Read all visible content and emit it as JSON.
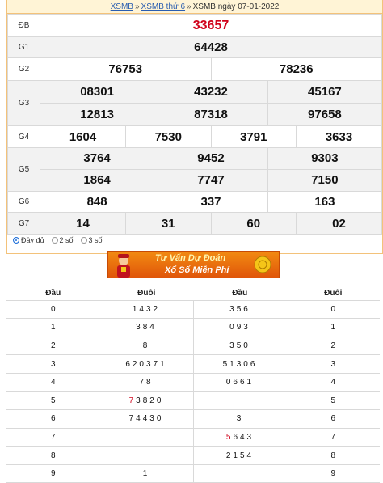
{
  "breadcrumb": {
    "link1": "XSMB",
    "link2": "XSMB thứ 6",
    "title": "XSMB ngày 07-01-2022"
  },
  "results": {
    "db": {
      "label": "ĐB",
      "nums": [
        "33657"
      ]
    },
    "g1": {
      "label": "G1",
      "nums": [
        "64428"
      ]
    },
    "g2": {
      "label": "G2",
      "nums": [
        "76753",
        "78236"
      ]
    },
    "g3": {
      "label": "G3",
      "nums": [
        "08301",
        "43232",
        "45167",
        "12813",
        "87318",
        "97658"
      ]
    },
    "g4": {
      "label": "G4",
      "nums": [
        "1604",
        "7530",
        "3791",
        "3633"
      ]
    },
    "g5": {
      "label": "G5",
      "nums": [
        "3764",
        "9452",
        "9303",
        "1864",
        "7747",
        "7150"
      ]
    },
    "g6": {
      "label": "G6",
      "nums": [
        "848",
        "337",
        "163"
      ]
    },
    "g7": {
      "label": "G7",
      "nums": [
        "14",
        "31",
        "60",
        "02"
      ]
    }
  },
  "options": {
    "full": "Đầy đủ",
    "two": "2 số",
    "three": "3 số"
  },
  "banner": {
    "line1": "Tư Vấn Dự Đoán",
    "line2": "Xổ Số Miễn Phí"
  },
  "loto": {
    "headers": [
      "Đầu",
      "Đuôi",
      "Đầu",
      "Đuôi"
    ],
    "rows": [
      {
        "dau": "0",
        "duoi": "1432",
        "dau2": "356",
        "duoi2": "0"
      },
      {
        "dau": "1",
        "duoi": "384",
        "dau2": "093",
        "duoi2": "1"
      },
      {
        "dau": "2",
        "duoi": "8",
        "dau2": "350",
        "duoi2": "2"
      },
      {
        "dau": "3",
        "duoi": "620371",
        "dau2": "51306",
        "duoi2": "3"
      },
      {
        "dau": "4",
        "duoi": "78",
        "dau2": "0661",
        "duoi2": "4"
      },
      {
        "dau": "5",
        "duoi_red": "7",
        "duoi": "3820",
        "dau2": "",
        "duoi2": "5"
      },
      {
        "dau": "6",
        "duoi": "74430",
        "dau2": "3",
        "duoi2": "6"
      },
      {
        "dau": "7",
        "duoi": "",
        "dau2_red": "5",
        "dau2": "643",
        "duoi2": "7"
      },
      {
        "dau": "8",
        "duoi": "",
        "dau2": "2154",
        "duoi2": "8"
      },
      {
        "dau": "9",
        "duoi": "1",
        "dau2": "",
        "duoi2": "9"
      }
    ]
  }
}
